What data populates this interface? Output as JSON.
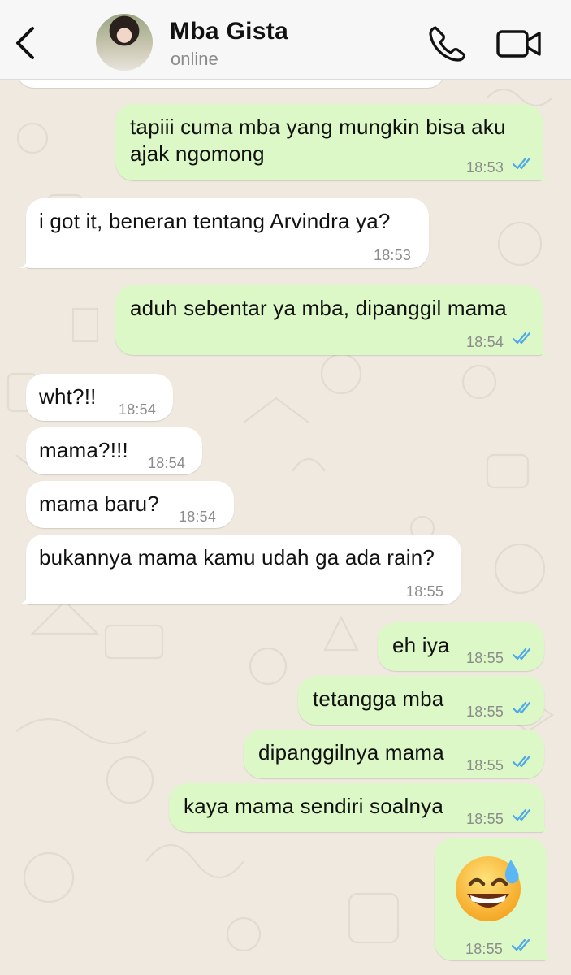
{
  "header": {
    "back_label": "back",
    "contact_name": "Mba Gista",
    "contact_status": "online",
    "icons": {
      "back": "chevron-left-icon",
      "call": "phone-icon",
      "video": "video-camera-icon"
    }
  },
  "colors": {
    "incoming_bubble": "#ffffff",
    "outgoing_bubble": "#dcf8c6",
    "read_ticks": "#4fa8e8",
    "wallpaper": "#efe9df"
  },
  "messages": [
    {
      "direction": "out",
      "lines": [
        "tapiii cuma mba yang mungkin bisa aku",
        "ajak ngomong"
      ],
      "time": "18:53",
      "status": "read"
    },
    {
      "direction": "in",
      "lines": [
        "i got it, beneran tentang Arvindra ya?"
      ],
      "time": "18:53"
    },
    {
      "direction": "out",
      "lines": [
        "aduh sebentar ya mba, dipanggil mama"
      ],
      "time": "18:54",
      "status": "read"
    },
    {
      "direction": "in",
      "lines": [
        "wht?!!"
      ],
      "time": "18:54"
    },
    {
      "direction": "in",
      "lines": [
        "mama?!!!"
      ],
      "time": "18:54"
    },
    {
      "direction": "in",
      "lines": [
        "mama baru?"
      ],
      "time": "18:54"
    },
    {
      "direction": "in",
      "lines": [
        "bukannya mama kamu udah ga ada rain?"
      ],
      "time": "18:55"
    },
    {
      "direction": "out",
      "lines": [
        "eh iya"
      ],
      "time": "18:55",
      "status": "read"
    },
    {
      "direction": "out",
      "lines": [
        "tetangga mba"
      ],
      "time": "18:55",
      "status": "read"
    },
    {
      "direction": "out",
      "lines": [
        "dipanggilnya mama"
      ],
      "time": "18:55",
      "status": "read"
    },
    {
      "direction": "out",
      "lines": [
        "kaya mama sendiri soalnya"
      ],
      "time": "18:55",
      "status": "read"
    },
    {
      "direction": "out",
      "emoji": "grinning-face-with-sweat-icon",
      "time": "18:55",
      "status": "read"
    }
  ]
}
